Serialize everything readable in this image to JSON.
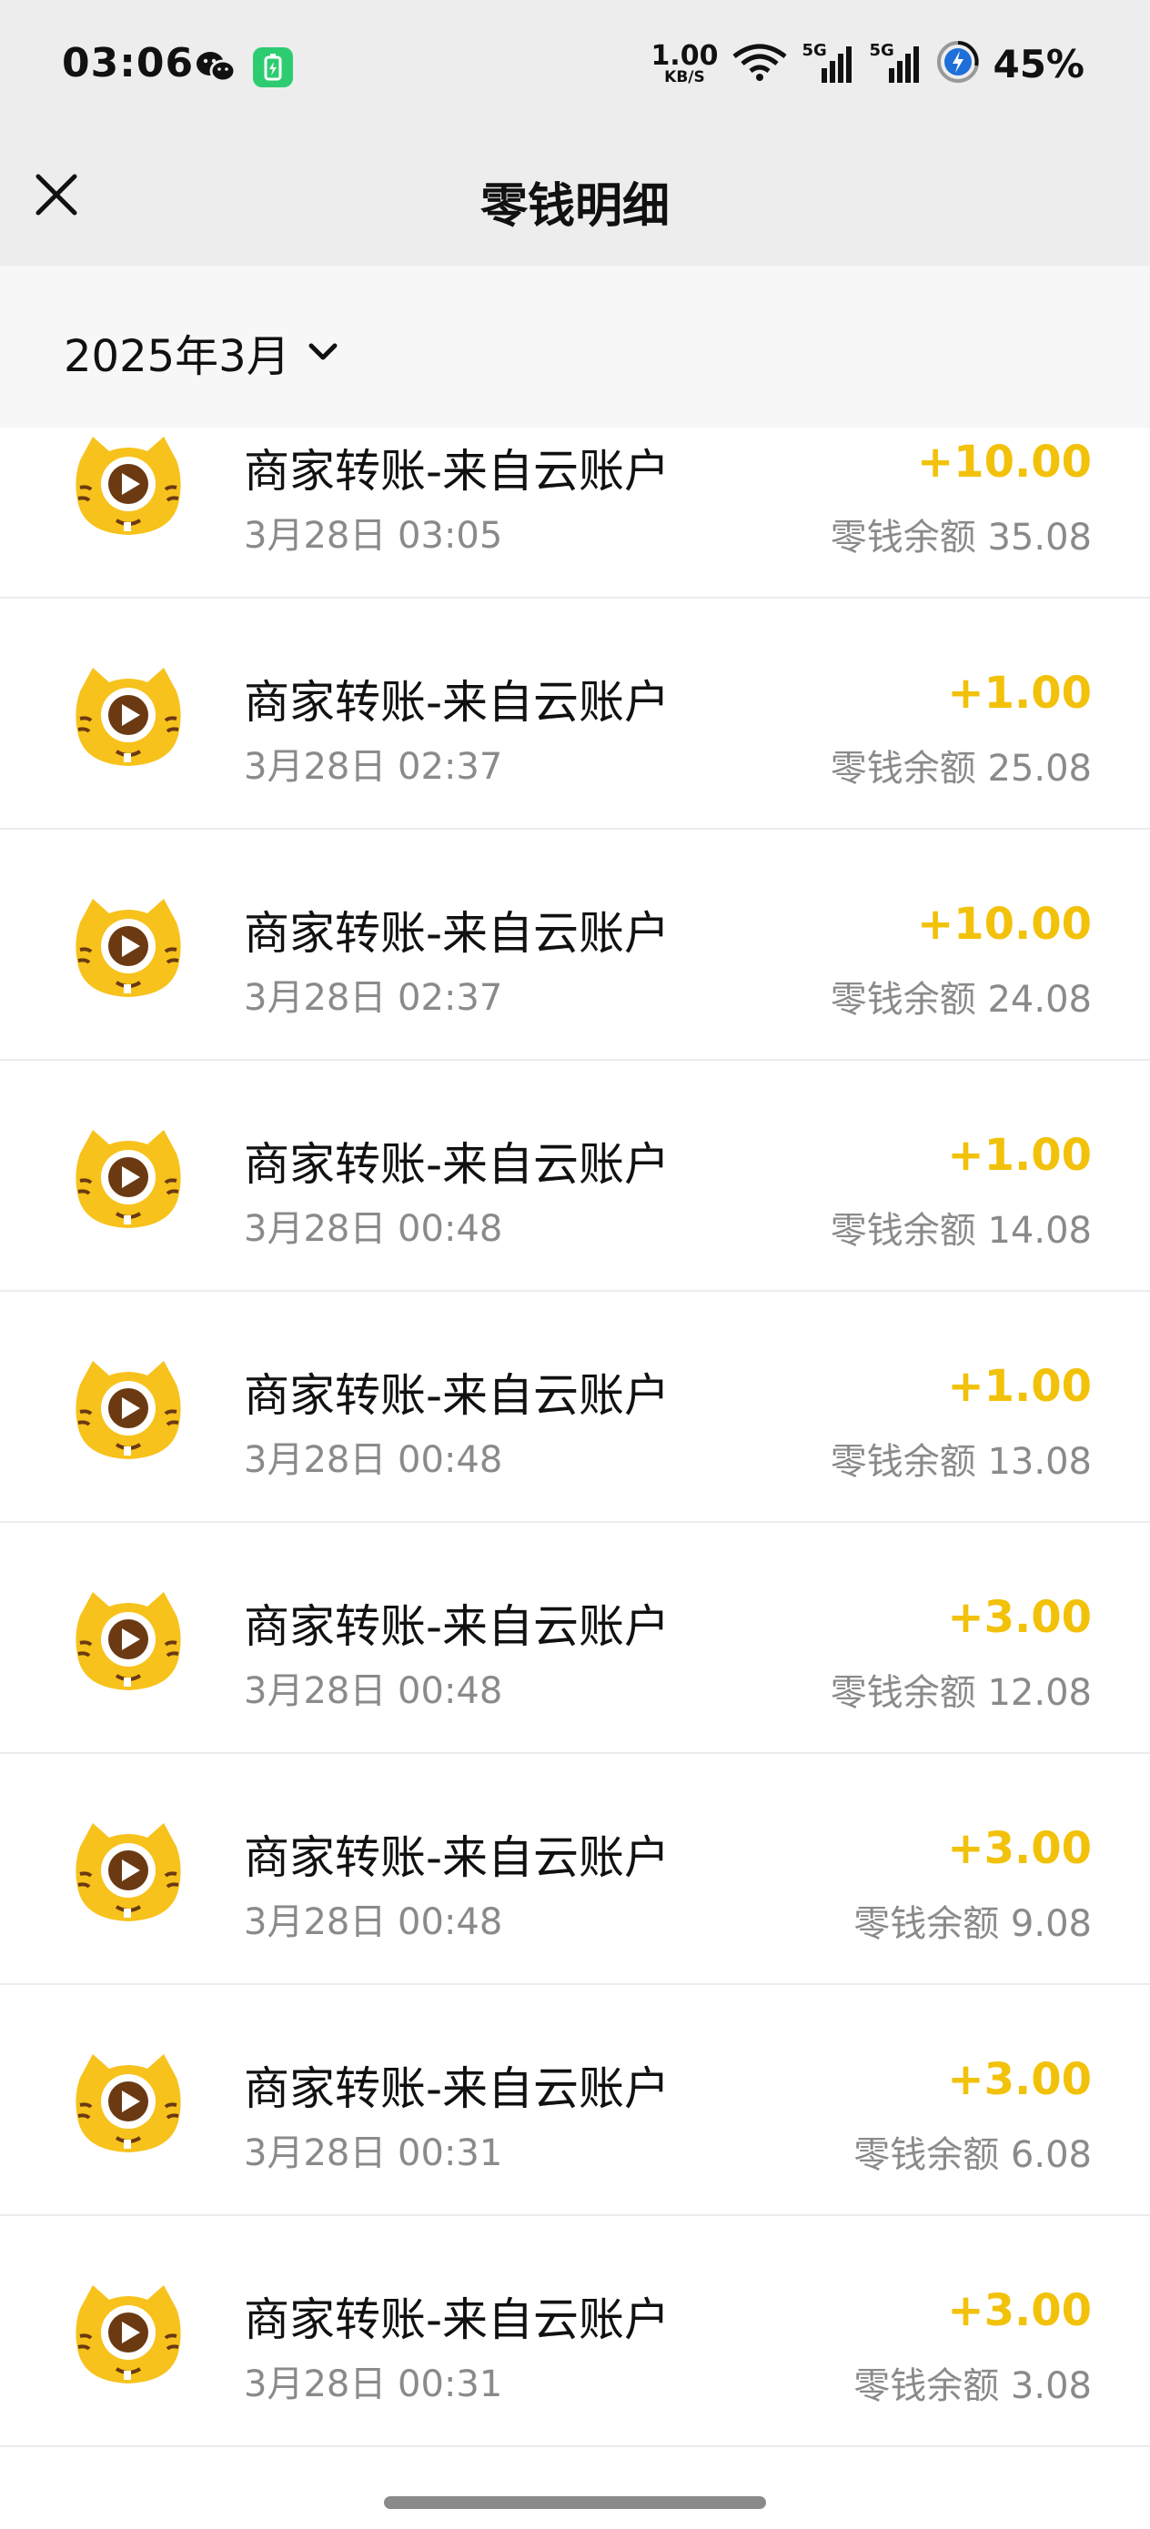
{
  "status_bar": {
    "time": "03:06",
    "net_speed_value": "1.00",
    "net_speed_unit": "KB/S",
    "signal_1_label": "5G",
    "signal_2_label": "5G",
    "battery_percent": "45%"
  },
  "nav": {
    "title": "零钱明细"
  },
  "filter": {
    "month": "2025年3月"
  },
  "colors": {
    "amount": "#f2c10a",
    "background": "#ededed",
    "list_background": "#ffffff"
  },
  "transactions": [
    {
      "title": "商家转账-来自云账户",
      "time": "3月28日 03:05",
      "amount": "+10.00",
      "balance": "零钱余额 35.08"
    },
    {
      "title": "商家转账-来自云账户",
      "time": "3月28日 02:37",
      "amount": "+1.00",
      "balance": "零钱余额 25.08"
    },
    {
      "title": "商家转账-来自云账户",
      "time": "3月28日 02:37",
      "amount": "+10.00",
      "balance": "零钱余额 24.08"
    },
    {
      "title": "商家转账-来自云账户",
      "time": "3月28日 00:48",
      "amount": "+1.00",
      "balance": "零钱余额 14.08"
    },
    {
      "title": "商家转账-来自云账户",
      "time": "3月28日 00:48",
      "amount": "+1.00",
      "balance": "零钱余额 13.08"
    },
    {
      "title": "商家转账-来自云账户",
      "time": "3月28日 00:48",
      "amount": "+3.00",
      "balance": "零钱余额 12.08"
    },
    {
      "title": "商家转账-来自云账户",
      "time": "3月28日 00:48",
      "amount": "+3.00",
      "balance": "零钱余额 9.08"
    },
    {
      "title": "商家转账-来自云账户",
      "time": "3月28日 00:31",
      "amount": "+3.00",
      "balance": "零钱余额 6.08"
    },
    {
      "title": "商家转账-来自云账户",
      "time": "3月28日 00:31",
      "amount": "+3.00",
      "balance": "零钱余额 3.08"
    }
  ]
}
